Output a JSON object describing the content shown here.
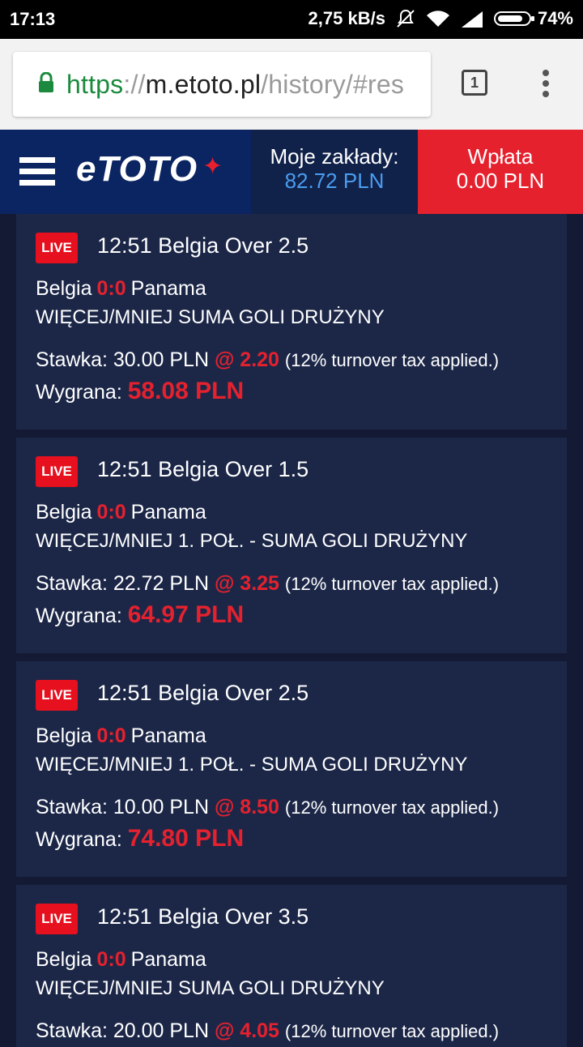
{
  "status_bar": {
    "time": "17:13",
    "speed": "2,75 kB/s",
    "battery": "74%"
  },
  "browser": {
    "url_scheme": "https",
    "url_separator": "://",
    "url_host": "m.etoto.pl",
    "url_path": "/history/#res",
    "tab_count": "1"
  },
  "header": {
    "logo": "eTOTO",
    "my_bets_label": "Moje zakłady:",
    "my_bets_value": "82.72 PLN",
    "deposit_label": "Wpłata",
    "deposit_value": "0.00 PLN",
    "colors": {
      "navy": "#0b2462",
      "red": "#e6212e",
      "blue_value": "#4a9cf0"
    }
  },
  "bets": [
    {
      "badge": "LIVE",
      "title": "12:51 Belgia Over 2.5",
      "home": "Belgia",
      "score": "0:0",
      "away": "Panama",
      "market": "WIĘCEJ/MNIEJ SUMA GOLI DRUŻYNY",
      "stake_label": "Stawka: 30.00 PLN",
      "odds": "@ 2.20",
      "tax_note": "(12% turnover tax applied.)",
      "win_label": "Wygrana:",
      "win_amount": "58.08 PLN"
    },
    {
      "badge": "LIVE",
      "title": "12:51 Belgia Over 1.5",
      "home": "Belgia",
      "score": "0:0",
      "away": "Panama",
      "market": "WIĘCEJ/MNIEJ 1. POŁ. - SUMA GOLI DRUŻYNY",
      "stake_label": "Stawka: 22.72 PLN",
      "odds": "@ 3.25",
      "tax_note": "(12% turnover tax applied.)",
      "win_label": "Wygrana:",
      "win_amount": "64.97 PLN"
    },
    {
      "badge": "LIVE",
      "title": "12:51 Belgia Over 2.5",
      "home": "Belgia",
      "score": "0:0",
      "away": "Panama",
      "market": "WIĘCEJ/MNIEJ 1. POŁ. - SUMA GOLI DRUŻYNY",
      "stake_label": "Stawka: 10.00 PLN",
      "odds": "@ 8.50",
      "tax_note": "(12% turnover tax applied.)",
      "win_label": "Wygrana:",
      "win_amount": "74.80 PLN"
    },
    {
      "badge": "LIVE",
      "title": "12:51 Belgia Over 3.5",
      "home": "Belgia",
      "score": "0:0",
      "away": "Panama",
      "market": "WIĘCEJ/MNIEJ SUMA GOLI DRUŻYNY",
      "stake_label": "Stawka: 20.00 PLN",
      "odds": "@ 4.05",
      "tax_note": "(12% turnover tax applied.)",
      "win_label": "",
      "win_amount": ""
    }
  ]
}
